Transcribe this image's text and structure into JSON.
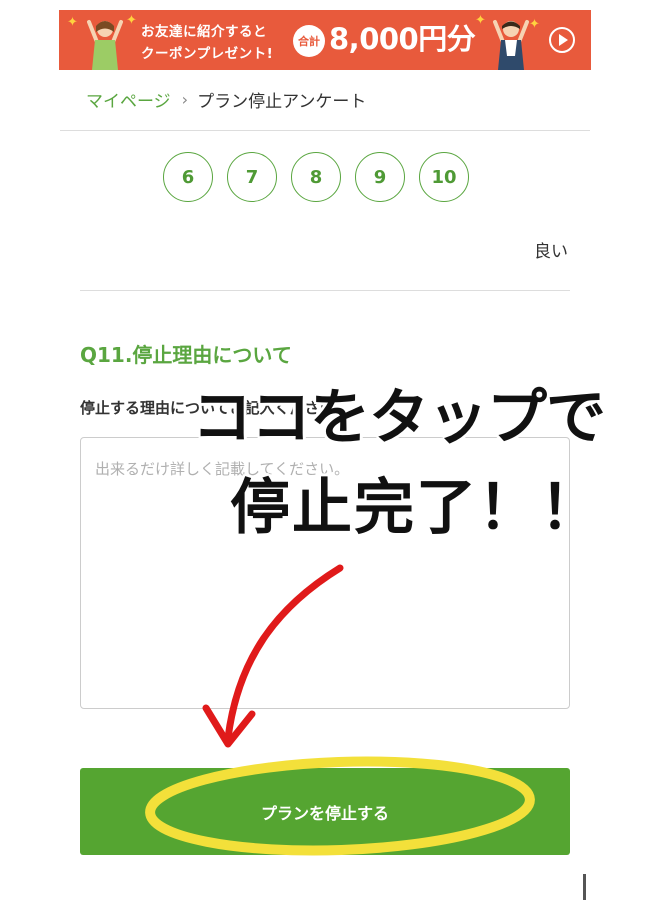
{
  "banner": {
    "line1": "お友達に紹介すると",
    "line2": "クーポンプレゼント!",
    "total_badge": "合計",
    "amount": "8,000円分",
    "bg_color": "#e85a3c",
    "play_icon": "play-icon"
  },
  "breadcrumb": {
    "home": "マイページ",
    "current": "プラン停止アンケート"
  },
  "rating": {
    "options": [
      "6",
      "7",
      "8",
      "9",
      "10"
    ],
    "good_label": "良い"
  },
  "question": {
    "title": "Q11.停止理由について",
    "label": "停止する理由についてご記入ください",
    "placeholder": "出来るだけ詳しく記載してください。"
  },
  "submit": {
    "label": "プランを停止する",
    "bg_color": "#55a531"
  },
  "annotation": {
    "line1": "ココをタップで",
    "line2": "停止完了！！",
    "arrow_color": "#e01a1a",
    "highlight_color": "#f3e03a"
  }
}
